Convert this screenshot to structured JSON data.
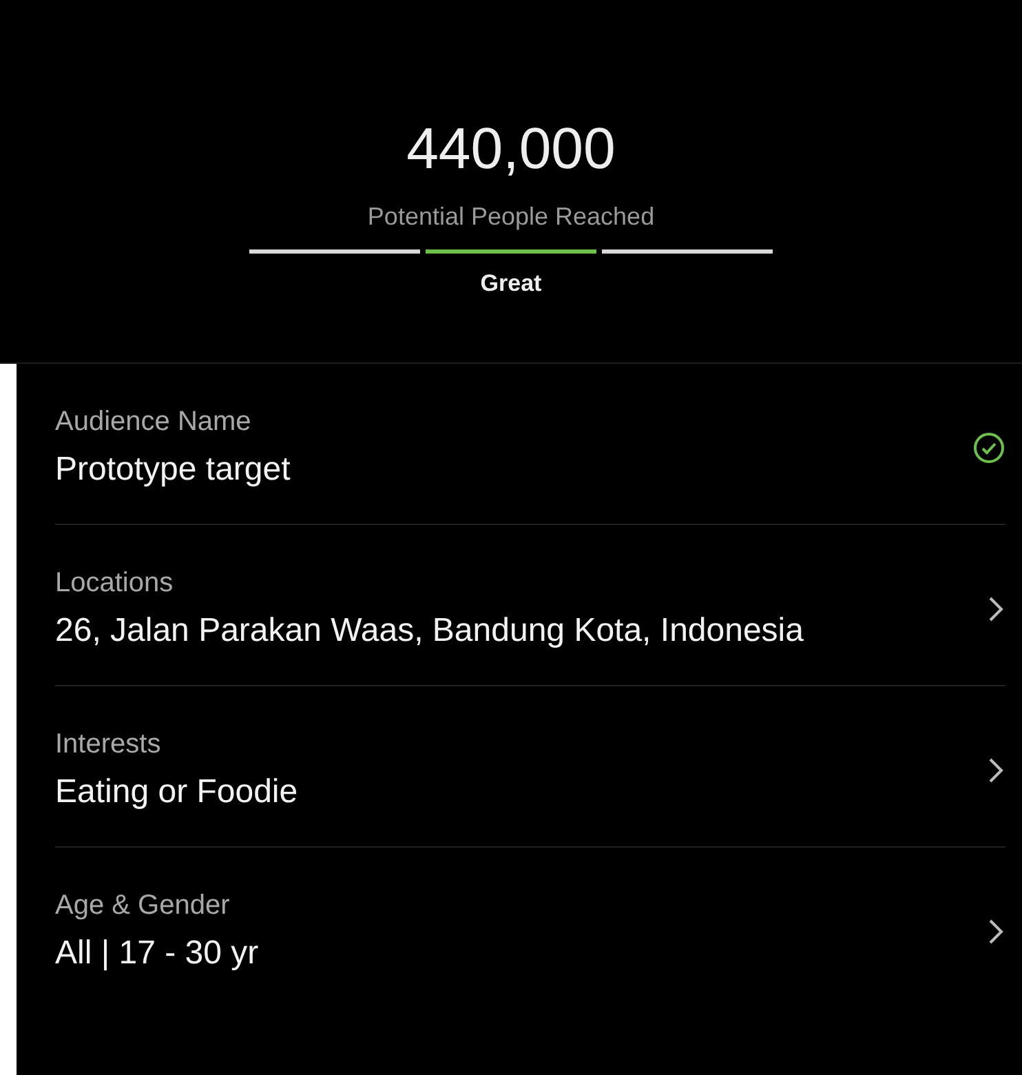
{
  "reach": {
    "count": "440,000",
    "caption": "Potential People Reached",
    "segments": [
      {
        "selected": false
      },
      {
        "selected": true
      },
      {
        "selected": false
      }
    ],
    "rating": "Great"
  },
  "fields": [
    {
      "label": "Audience Name",
      "value": "Prototype target",
      "kind": "check"
    },
    {
      "label": "Locations",
      "value": "26, Jalan Parakan Waas, Bandung Kota, Indonesia",
      "kind": "chevron"
    },
    {
      "label": "Interests",
      "value": "Eating or Foodie",
      "kind": "chevron"
    },
    {
      "label": "Age & Gender",
      "value": "All | 17 - 30 yr",
      "kind": "chevron"
    }
  ]
}
